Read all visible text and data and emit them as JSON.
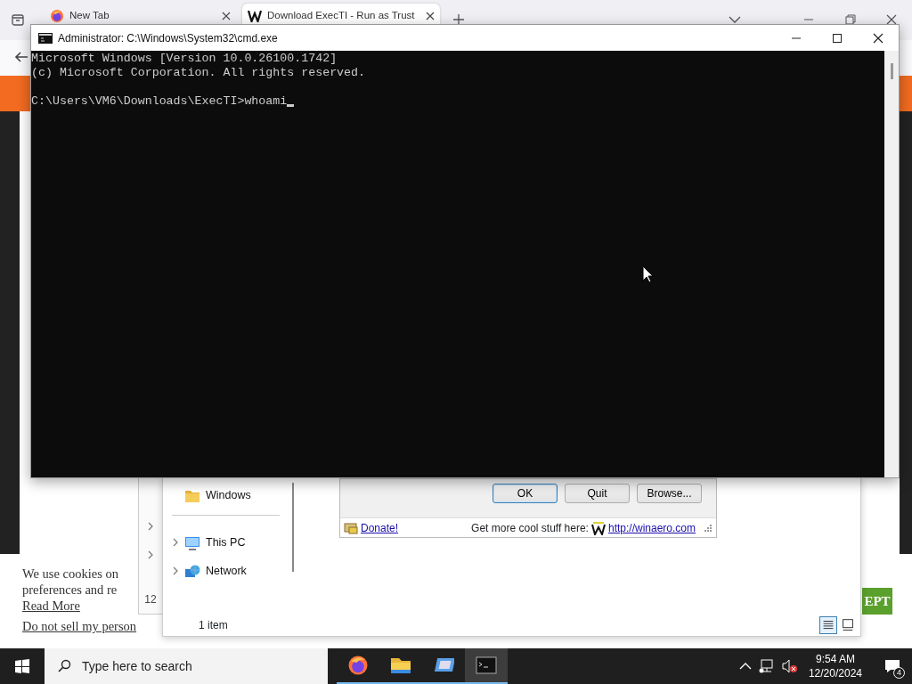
{
  "browser": {
    "tabs": [
      {
        "label": "New Tab",
        "selected": false,
        "kind": "firefox"
      },
      {
        "label": "Download ExecTI - Run as Trust",
        "selected": true,
        "kind": "winaero"
      }
    ]
  },
  "cookie_banner": {
    "lines": [
      "We use cookies on",
      "preferences and re"
    ],
    "links": [
      "Read More",
      "Do not sell my person"
    ],
    "button": "EPT"
  },
  "explorer": {
    "nav_items": [
      {
        "label": "Windows",
        "kind": "folder",
        "expandable": false
      },
      {
        "label": "This PC",
        "kind": "pc",
        "expandable": true
      },
      {
        "label": "Network",
        "kind": "network",
        "expandable": true
      }
    ],
    "partial_text": "12",
    "status": "1 item",
    "view_modes": [
      {
        "kind": "details",
        "selected": true
      },
      {
        "kind": "tiles",
        "selected": false
      }
    ]
  },
  "execti_dialog": {
    "buttons": [
      {
        "label": "OK",
        "default": true
      },
      {
        "label": "Quit",
        "default": false
      },
      {
        "label": "Browse...",
        "default": false
      }
    ],
    "donate": "Donate!",
    "promo_text": "Get more cool stuff here:",
    "promo_link": "http://winaero.com"
  },
  "cmd": {
    "title": "Administrator: C:\\Windows\\System32\\cmd.exe",
    "lines": [
      "Microsoft Windows [Version 10.0.26100.1742]",
      "(c) Microsoft Corporation. All rights reserved."
    ],
    "prompt": "C:\\Users\\VM6\\Downloads\\ExecTI>",
    "input": "whoami"
  },
  "taskbar": {
    "search_placeholder": "Type here to search",
    "apps": [
      {
        "kind": "firefox",
        "active": false
      },
      {
        "kind": "folder",
        "active": false
      },
      {
        "kind": "tool",
        "active": false
      },
      {
        "kind": "console",
        "active": true
      }
    ],
    "time": "9:54 AM",
    "date": "12/20/2024",
    "notification_count": "4"
  }
}
